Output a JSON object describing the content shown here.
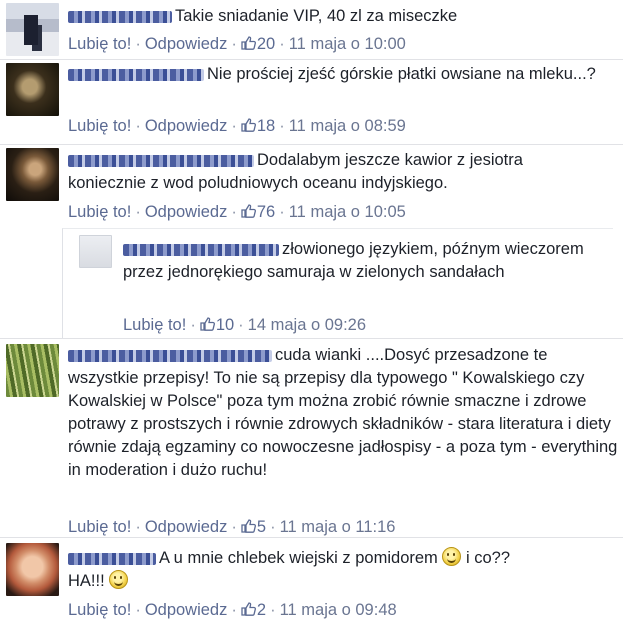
{
  "ui": {
    "like_label": "Lubię to!",
    "reply_label": "Odpowiedz",
    "separator": "·"
  },
  "comments": [
    {
      "text": "Takie sniadanie VIP, 40 zl za miseczke",
      "likes": "20",
      "date": "11 maja o 10:00"
    },
    {
      "text": "Nie prościej zjeść górskie płatki owsiane na mleku...?",
      "likes": "18",
      "date": "11 maja o 08:59"
    },
    {
      "text": "Dodalabym jeszcze kawior z jesiotra koniecznie z wod poludniowych oceanu indyjskiego.",
      "likes": "76",
      "date": "11 maja o 10:05"
    },
    {
      "text": "złowionego językiem, późnym wieczorem przez jednorękiego samuraja w zielonych sandałach",
      "likes": "10",
      "date": "14 maja o 09:26"
    },
    {
      "text": "cuda wianki ....Dosyć przesadzone te wszystkie przepisy! To nie są przepisy dla typowego \" Kowalskiego czy Kowalskiej w Polsce\" poza tym można zrobić równie smaczne i zdrowe potrawy z prostszych i równie zdrowych składników - stara literatura i diety równie zdają egzaminy co nowoczesne jadłospisy - a poza tym - everything in moderation i dużo ruchu!",
      "likes": "5",
      "date": "11 maja o 11:16"
    },
    {
      "text_part1": "A u mnie chlebek wiejski z pomidorem",
      "text_part2": "i co??",
      "text_part3": "HA!!!",
      "likes": "2",
      "date": "11 maja o 09:48"
    }
  ]
}
